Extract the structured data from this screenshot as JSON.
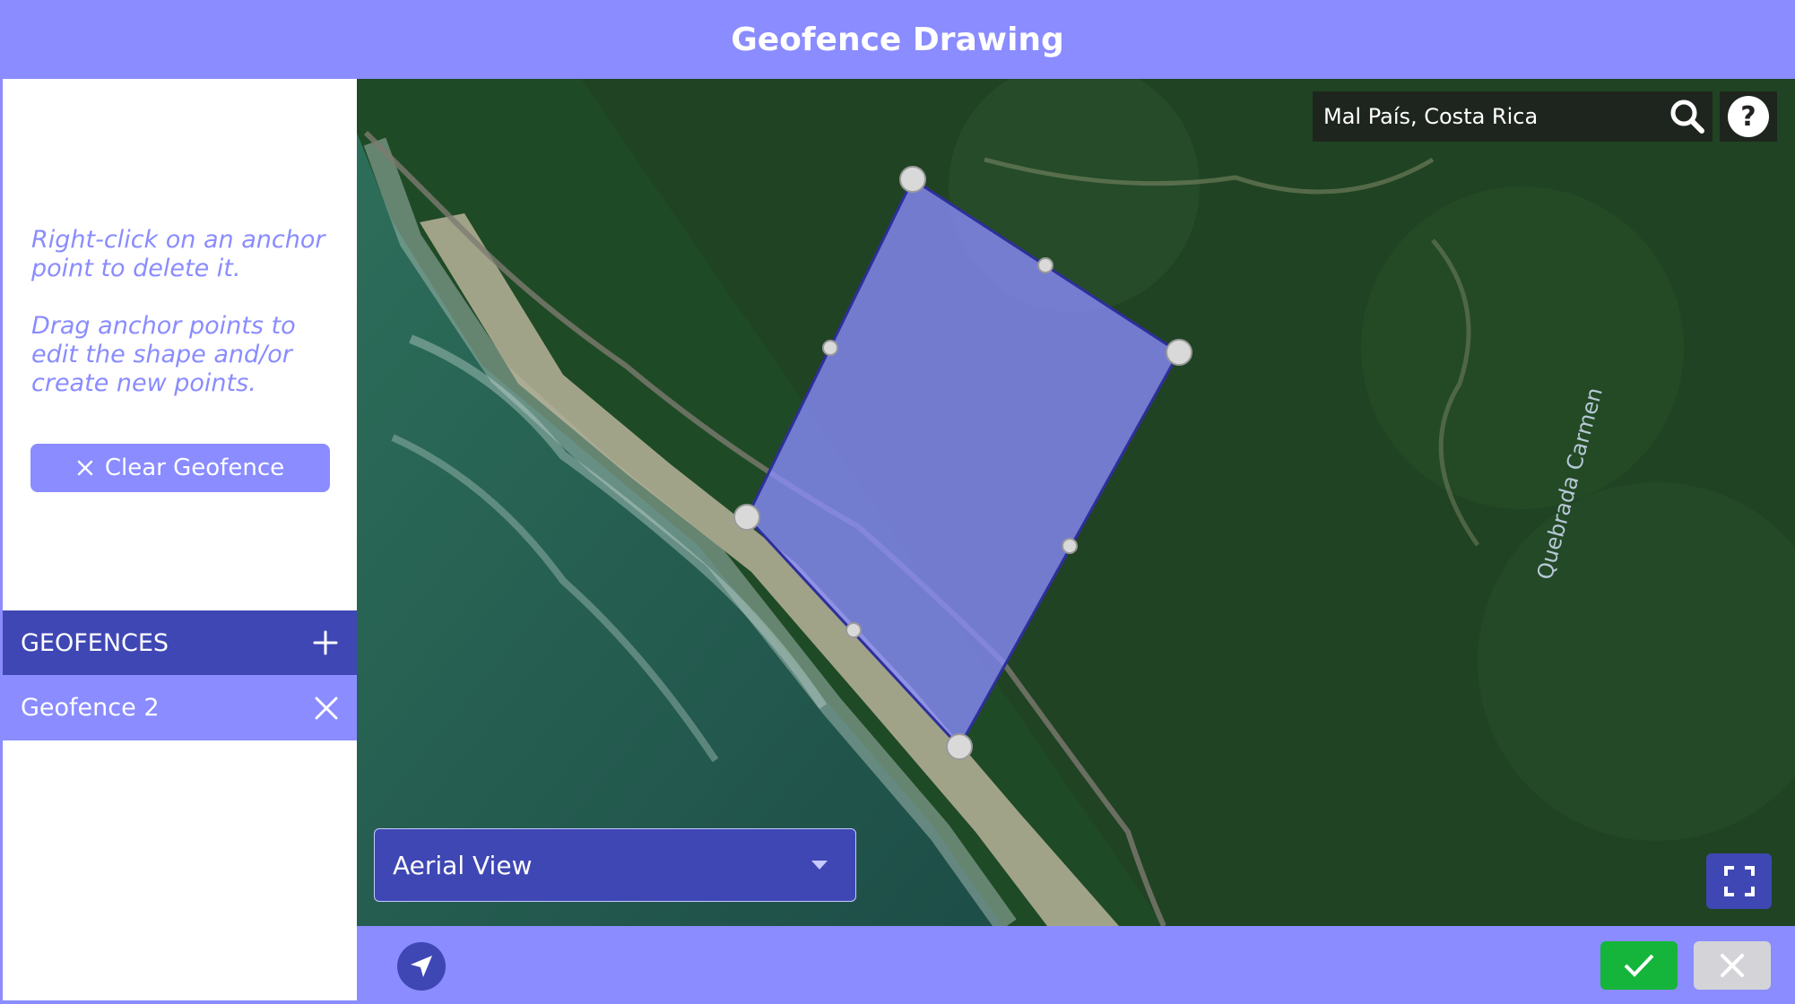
{
  "header": {
    "title": "Geofence Drawing"
  },
  "sidebar": {
    "hint_delete": "Right-click on an anchor point to delete it.",
    "hint_drag": "Drag anchor points to edit the shape and/or create new points.",
    "clear_button_label": "Clear Geofence",
    "geofences_heading": "GEOFENCES",
    "geofences": [
      {
        "name": "Geofence 2"
      }
    ]
  },
  "map": {
    "search_value": "Mal País, Costa Rica",
    "map_label": "Quebrada Carmen",
    "view_select": {
      "selected": "Aerial View"
    },
    "polygon_color": "#8a8cff"
  },
  "colors": {
    "accent": "#8a8cff",
    "primary_dark": "#3f47b4",
    "confirm": "#14b53a",
    "cancel": "#d4d4d8"
  }
}
